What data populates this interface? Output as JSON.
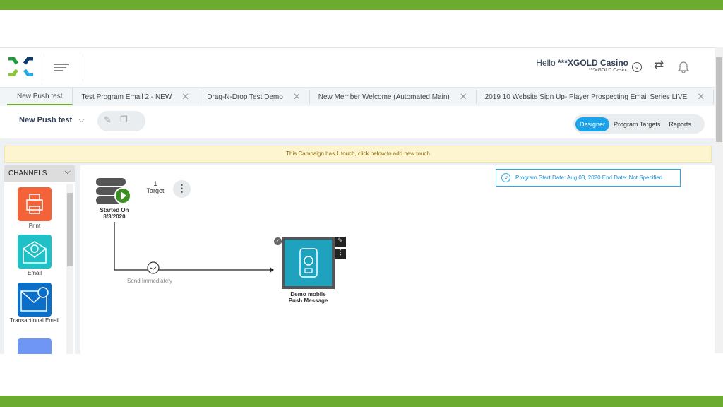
{
  "header": {
    "greeting_prefix": "Hello ",
    "user_name": "***XGOLD Casino",
    "sub_account": "***XGOLD Casino"
  },
  "tabs": [
    {
      "label": "New Push test",
      "active": true
    },
    {
      "label": "Test Program Email 2 - NEW"
    },
    {
      "label": "Drag-N-Drop Test Demo"
    },
    {
      "label": "New Member Welcome (Automated Main)"
    },
    {
      "label": "2019 10 Website Sign Up- Player Prospecting Email Series LIVE"
    }
  ],
  "toolbar": {
    "program_name": "New Push test",
    "views": [
      "Designer",
      "Program Targets",
      "Reports"
    ],
    "active_view": "Designer"
  },
  "banner": "This Campaign has 1 touch, click below to add new touch",
  "sidebar": {
    "title": "CHANNELS",
    "items": [
      {
        "label": "Print",
        "color": "#f4623a"
      },
      {
        "label": "Email",
        "color": "#1fc1c7"
      },
      {
        "label": "Transactional Email",
        "color": "#0b6fc9"
      },
      {
        "label": "",
        "color": "#6f96f5"
      }
    ]
  },
  "canvas": {
    "start": {
      "line1": "Started On",
      "line2": "8/3/2020"
    },
    "target_count": "1",
    "target_label": "Target",
    "connector_label": "Send Immediately",
    "touch": {
      "line1": "Demo mobile",
      "line2": "Push Message"
    },
    "program_dates": "Program Start Date: Aug 03, 2020 End Date: Not Specified"
  },
  "colors": {
    "brand_green": "#6bab2f",
    "accent_blue": "#1aa3e8",
    "touch_teal": "#1fa2bd"
  }
}
